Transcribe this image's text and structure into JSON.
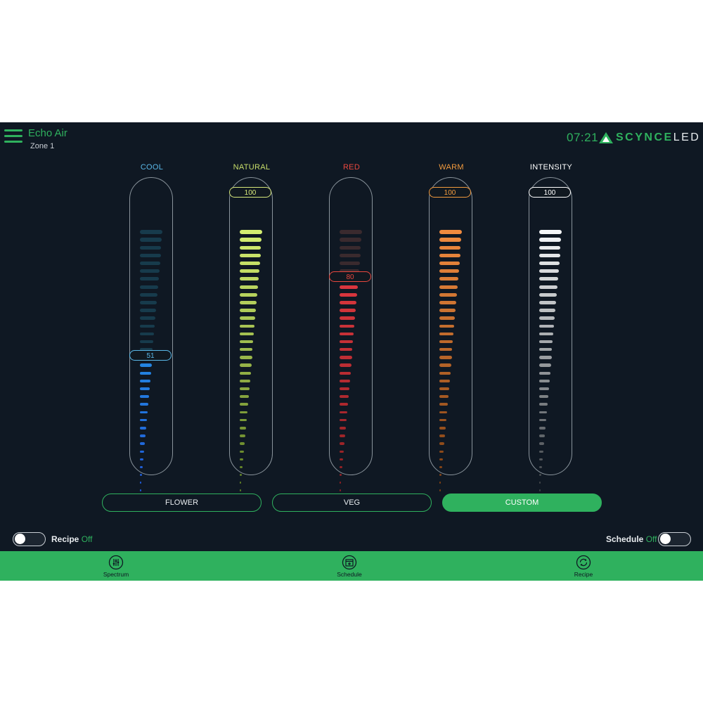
{
  "header": {
    "app_name": "Echo Air",
    "zone": "Zone 1",
    "time": "07:21",
    "brand": {
      "bold": "SCYNCE",
      "light": "LED"
    }
  },
  "channels": [
    {
      "label": "COOL",
      "value": 51,
      "label_color": "#5ab8e8",
      "lit_colors": [
        "#1f57d6",
        "#27b3ec"
      ],
      "dim_color": "#173b4c",
      "badge_color": "#5ab8e8"
    },
    {
      "label": "NATURAL",
      "value": 100,
      "label_color": "#c8de6a",
      "lit_colors": [
        "#5a7a22",
        "#d4ee70"
      ],
      "dim_color": "#3a4a1a",
      "badge_color": "#d6e77a"
    },
    {
      "label": "RED",
      "value": 80,
      "label_color": "#e8473e",
      "lit_colors": [
        "#8a1e22",
        "#ef3d45"
      ],
      "dim_color": "#3a2a2e",
      "badge_color": "#e8473e"
    },
    {
      "label": "WARM",
      "value": 100,
      "label_color": "#f19a3e",
      "lit_colors": [
        "#7a3d12",
        "#f08a3e"
      ],
      "dim_color": "#3b2a1c",
      "badge_color": "#f19a3e"
    },
    {
      "label": "INTENSITY",
      "value": 100,
      "label_color": "#ffffff",
      "lit_colors": [
        "#3a3f44",
        "#f4f6f8"
      ],
      "dim_color": "#2c3238",
      "badge_color": "#ffffff"
    }
  ],
  "presets": [
    {
      "label": "FLOWER",
      "active": false
    },
    {
      "label": "VEG",
      "active": false
    },
    {
      "label": "CUSTOM",
      "active": true
    }
  ],
  "recipe_toggle": {
    "label": "Recipe",
    "state": "Off"
  },
  "schedule_toggle": {
    "label": "Schedule",
    "state": "Off"
  },
  "nav": [
    {
      "label": "Spectrum",
      "icon": "spectrum-icon"
    },
    {
      "label": "Schedule",
      "icon": "calendar-icon"
    },
    {
      "label": "Recipe",
      "icon": "recipe-icon"
    }
  ],
  "colors": {
    "accent": "#2fb15e",
    "background": "#0f1823",
    "track_border": "#8a949c"
  }
}
